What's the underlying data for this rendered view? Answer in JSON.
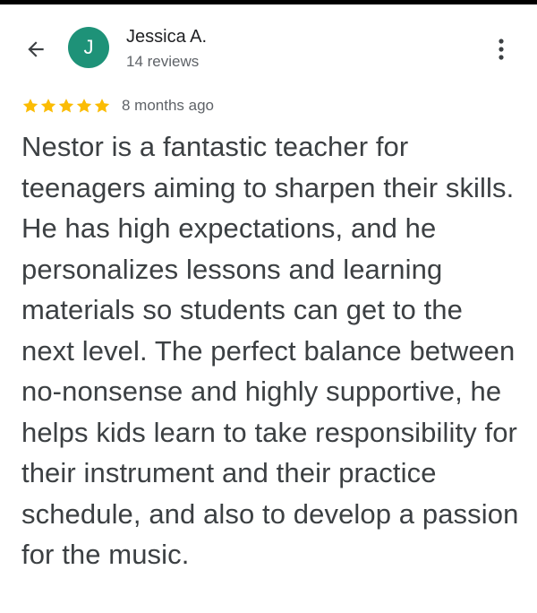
{
  "reviewer": {
    "name": "Jessica A.",
    "meta": "14 reviews",
    "avatar_initial": "J",
    "avatar_color": "#1e9278"
  },
  "header": {
    "back_icon": "arrow-back-icon",
    "more_icon": "more-vert-icon"
  },
  "review": {
    "rating": 5,
    "max_rating": 5,
    "star_color": "#fbbc04",
    "date": "8 months ago",
    "text": "Nestor is a fantastic teacher for teenagers aiming to sharpen their skills. He has high expectations, and he personalizes lessons and learning materials so students can get to the next level. The perfect balance between no-nonsense and highly supportive, he helps kids learn to take responsibility for their instrument and their practice schedule, and also to develop a passion for the music."
  }
}
